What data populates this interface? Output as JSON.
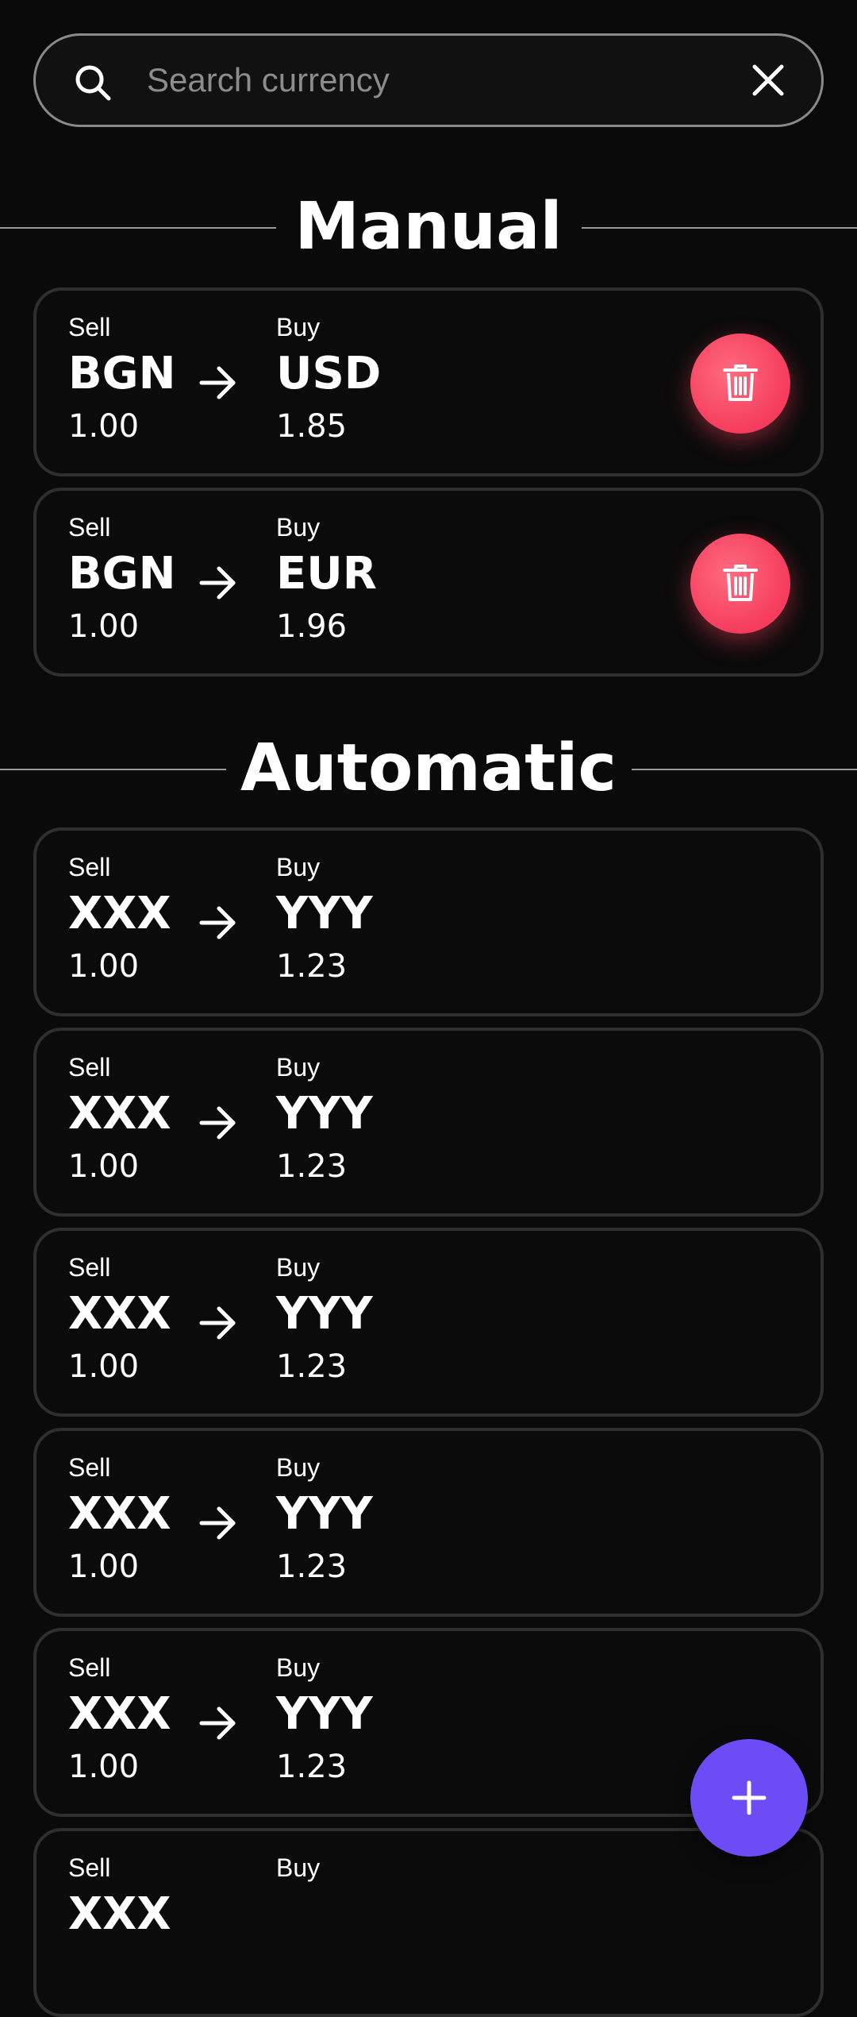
{
  "search": {
    "placeholder": "Search currency",
    "value": ""
  },
  "sections": {
    "manual": {
      "title": "Manual"
    },
    "automatic": {
      "title": "Automatic"
    }
  },
  "manual_rates": [
    {
      "sell_label": "Sell",
      "sell_code": "BGN",
      "sell_amount": "1.00",
      "buy_label": "Buy",
      "buy_code": "USD",
      "buy_amount": "1.85"
    },
    {
      "sell_label": "Sell",
      "sell_code": "BGN",
      "sell_amount": "1.00",
      "buy_label": "Buy",
      "buy_code": "EUR",
      "buy_amount": "1.96"
    }
  ],
  "automatic_rates": [
    {
      "sell_label": "Sell",
      "sell_code": "XXX",
      "sell_amount": "1.00",
      "buy_label": "Buy",
      "buy_code": "YYY",
      "buy_amount": "1.23"
    },
    {
      "sell_label": "Sell",
      "sell_code": "XXX",
      "sell_amount": "1.00",
      "buy_label": "Buy",
      "buy_code": "YYY",
      "buy_amount": "1.23"
    },
    {
      "sell_label": "Sell",
      "sell_code": "XXX",
      "sell_amount": "1.00",
      "buy_label": "Buy",
      "buy_code": "YYY",
      "buy_amount": "1.23"
    },
    {
      "sell_label": "Sell",
      "sell_code": "XXX",
      "sell_amount": "1.00",
      "buy_label": "Buy",
      "buy_code": "YYY",
      "buy_amount": "1.23"
    },
    {
      "sell_label": "Sell",
      "sell_code": "XXX",
      "sell_amount": "1.00",
      "buy_label": "Buy",
      "buy_code": "YYY",
      "buy_amount": "1.23"
    },
    {
      "sell_label": "Sell",
      "sell_code": "XXX",
      "sell_amount": "",
      "buy_label": "Buy",
      "buy_code": "",
      "buy_amount": ""
    }
  ],
  "icons": {
    "search": "search-icon",
    "clear": "close-icon",
    "arrow": "arrow-right-icon",
    "delete": "trash-icon",
    "add": "plus-icon"
  },
  "colors": {
    "background": "#0a0a0a",
    "delete_button": "#f53c5c",
    "fab": "#6d4cf6",
    "card_border": "#2f2f2f"
  }
}
